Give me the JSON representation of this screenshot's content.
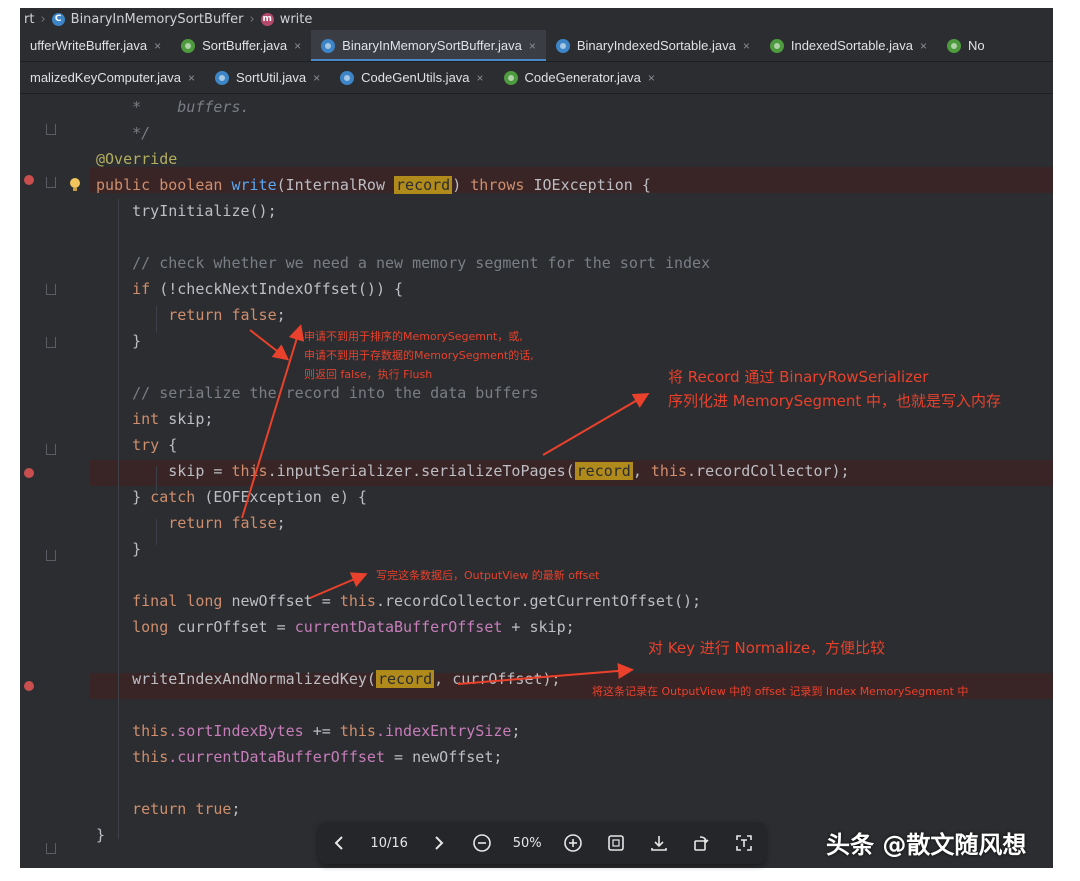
{
  "breadcrumb": {
    "part0": "rt",
    "class_name": "BinaryInMemorySortBuffer",
    "method_name": "write"
  },
  "tabs_row1": [
    {
      "label": "ufferWriteBuffer.java",
      "icon": "class-icon",
      "active": false
    },
    {
      "label": "SortBuffer.java",
      "icon": "interface-icon",
      "active": false
    },
    {
      "label": "BinaryInMemorySortBuffer.java",
      "icon": "class-icon",
      "active": true
    },
    {
      "label": "BinaryIndexedSortable.java",
      "icon": "class-icon",
      "active": false
    },
    {
      "label": "IndexedSortable.java",
      "icon": "interface-icon",
      "active": false
    },
    {
      "label": "No",
      "icon": "interface-icon",
      "active": false
    }
  ],
  "tabs_row2": [
    {
      "label": "malizedKeyComputer.java",
      "icon": "interface-icon"
    },
    {
      "label": "SortUtil.java",
      "icon": "class-icon"
    },
    {
      "label": "CodeGenUtils.java",
      "icon": "class-icon"
    },
    {
      "label": "CodeGenerator.java",
      "icon": "interface-icon"
    }
  ],
  "tab_close_glyph": "×",
  "code": {
    "l1_star": "*",
    "l1_text": "buffers.",
    "l2": "*/",
    "l3": "@Override",
    "l4": {
      "kw1": "public",
      "kw2": "boolean",
      "fn": "write",
      "p1": "(InternalRow ",
      "sel": "record",
      "p2": ") ",
      "kw3": "throws",
      "p3": " IOException {"
    },
    "l5": "tryInitialize();",
    "l7": "// check whether we need a new memory segment for the sort index",
    "l8": {
      "kw": "if",
      "rest": " (!checkNextIndexOffset()) {"
    },
    "l9": {
      "kw": "return",
      "val": "false",
      "semi": ";"
    },
    "l10": "}",
    "l12": "// serialize the record into the data buffers",
    "l13": {
      "kw": "int",
      "rest": " skip;"
    },
    "l14": {
      "kw": "try",
      "rest": " {"
    },
    "l15": {
      "a": "skip = ",
      "kw": "this",
      "b": ".inputSerializer.serializeToPages(",
      "sel": "record",
      "c": ", ",
      "kw2": "this",
      "d": ".recordCollector);"
    },
    "l16": {
      "a": "} ",
      "kw": "catch",
      "b": " (EOFException e) {"
    },
    "l17": {
      "kw": "return",
      "val": "false",
      "semi": ";"
    },
    "l18": "}",
    "l20": {
      "kw1": "final",
      "kw2": "long",
      "a": " newOffset = ",
      "kw3": "this",
      "b": ".recordCollector.getCurrentOffset();"
    },
    "l21": {
      "kw": "long",
      "a": " currOffset = ",
      "fld": "currentDataBufferOffset",
      "b": " + skip;"
    },
    "l23": {
      "a": "writeIndexAndNormalizedKey(",
      "sel": "record",
      "b": ", currOffset);"
    },
    "l25": {
      "kw": "this",
      "fld": ".sortIndexBytes",
      "a": " += ",
      "kw2": "this",
      "fld2": ".indexEntrySize",
      "b": ";"
    },
    "l26": {
      "kw": "this",
      "fld": ".currentDataBufferOffset",
      "a": " = newOffset;"
    },
    "l28": {
      "kw": "return",
      "val": " true",
      "semi": ";"
    },
    "l29": "}"
  },
  "annotations": {
    "a1_l1": "申请不到用于排序的MemorySegemnt，或,",
    "a1_l2": "申请不到用于存数据的MemorySegment的话,",
    "a1_l3": "则返回 false，执行 Flush",
    "a2_l1": "将 Record 通过 BinaryRowSerializer",
    "a2_l2": "序列化进 MemorySegment 中，也就是写入内存",
    "a3": "写完这条数据后，OutputView 的最新 offset",
    "a4": "对 Key 进行 Normalize，方便比较",
    "a5": "将这条记录在 OutputView 中的 offset 记录到 Index MemorySegment 中"
  },
  "annotation_color": "#e9412c",
  "pdf_toolbar": {
    "page_indicator": "10/16",
    "zoom": "50%"
  },
  "watermark": "头条 @散文随风想"
}
